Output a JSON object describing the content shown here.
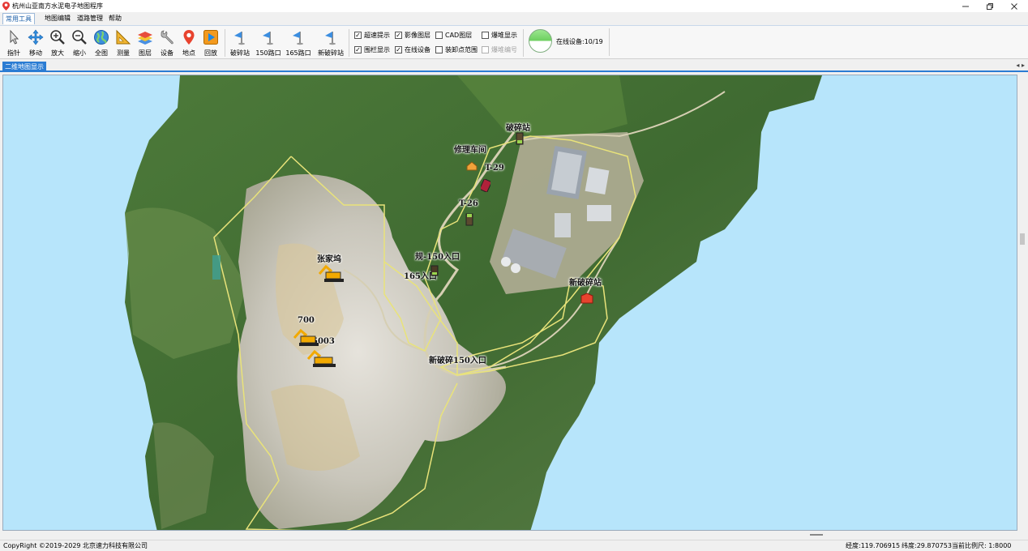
{
  "window": {
    "title": "杭州山亚南方水泥电子地图程序",
    "controls": [
      "minimize",
      "maximize",
      "close"
    ]
  },
  "menu": [
    "常用工具",
    "地图编辑",
    "道路管理",
    "帮助"
  ],
  "toolbar": {
    "tools": [
      {
        "label": "指针",
        "icon": "pointer-icon"
      },
      {
        "label": "移动",
        "icon": "move-icon"
      },
      {
        "label": "放大",
        "icon": "zoom-in-icon"
      },
      {
        "label": "缩小",
        "icon": "zoom-out-icon"
      },
      {
        "label": "全图",
        "icon": "globe-icon"
      },
      {
        "label": "测量",
        "icon": "ruler-icon"
      },
      {
        "label": "图层",
        "icon": "layers-icon"
      },
      {
        "label": "设备",
        "icon": "wrench-icon"
      },
      {
        "label": "地点",
        "icon": "location-pin-icon"
      },
      {
        "label": "回放",
        "icon": "playback-icon"
      }
    ],
    "stations": [
      {
        "label": "破碎站",
        "icon": "flag-icon"
      },
      {
        "label": "150路口",
        "icon": "flag-icon"
      },
      {
        "label": "165路口",
        "icon": "flag-icon"
      },
      {
        "label": "新破碎站",
        "icon": "flag-icon"
      }
    ],
    "checkboxes": [
      {
        "label": "超速提示",
        "checked": true,
        "disabled": false
      },
      {
        "label": "影像图层",
        "checked": true,
        "disabled": false
      },
      {
        "label": "CAD图层",
        "checked": false,
        "disabled": false
      },
      {
        "label": "爆堆显示",
        "checked": false,
        "disabled": false
      },
      {
        "label": "围栏显示",
        "checked": true,
        "disabled": false
      },
      {
        "label": "在线设备",
        "checked": true,
        "disabled": false
      },
      {
        "label": "装卸点范围",
        "checked": false,
        "disabled": false
      },
      {
        "label": "爆堆编号",
        "checked": false,
        "disabled": true
      }
    ],
    "online_label": "在线设备:10/19",
    "online_fraction": 0.526,
    "colors": {
      "online_fill": "#7bd96c",
      "tab_accent": "#2b7cd3"
    }
  },
  "tab": {
    "label": "二维地图显示"
  },
  "map": {
    "labels": [
      "破碎站",
      "修理车间",
      "T-29",
      "T-26",
      "规-150入口",
      "165入口",
      "张家坞",
      "700",
      "5003",
      "新破碎站",
      "新破碎150入口"
    ]
  },
  "status": {
    "copyright": "CopyRight  ©2019-2029 北京速力科技有限公司",
    "longitude": "经度:119.706915",
    "latitude": "纬度:29.870753",
    "scale": "当前比例尺: 1:8000"
  }
}
